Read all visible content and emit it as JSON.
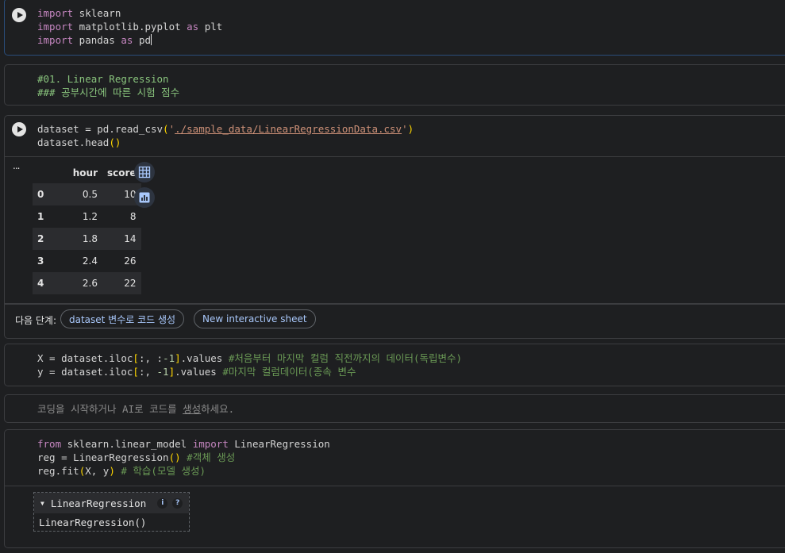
{
  "cells": {
    "import": {
      "lines": [
        {
          "kw": "import",
          "rest": " sklearn"
        },
        {
          "kw": "import",
          "rest": " matplotlib.pyplot ",
          "kw2": "as",
          "rest2": " plt"
        },
        {
          "kw": "import",
          "rest": " pandas ",
          "kw2": "as",
          "rest2": " pd"
        }
      ]
    },
    "markdown1": {
      "line1": "#01. Linear Regression",
      "line2": "### 공부시간에 따른 시험 점수"
    },
    "readcsv": {
      "l1_a": "dataset = pd.read_csv",
      "l1_paren_open": "(",
      "l1_quote_open": "'",
      "l1_path": "./sample_data/LinearRegressionData.csv",
      "l1_quote_close": "'",
      "l1_paren_close": ")",
      "l2_a": "dataset.head",
      "l2_parens": "()"
    },
    "output": {
      "ellipsis": "...",
      "table": {
        "columns": [
          "",
          "hour",
          "score"
        ],
        "rows": [
          [
            "0",
            "0.5",
            "10"
          ],
          [
            "1",
            "1.2",
            "8"
          ],
          [
            "2",
            "1.8",
            "14"
          ],
          [
            "3",
            "2.4",
            "26"
          ],
          [
            "4",
            "2.6",
            "22"
          ]
        ]
      },
      "next_steps_label": "다음 단계:",
      "chip1": "dataset 변수로 코드 생성",
      "chip2": "New interactive sheet",
      "table_icon": "table-icon",
      "chart_icon": "bar-chart-icon"
    },
    "iloc": {
      "l1_a": "X = dataset.iloc",
      "l1_b": "[",
      "l1_c": ":, :",
      "l1_d": "-1",
      "l1_e": "]",
      "l1_f": ".values ",
      "l1_cm": "#처음부터 마지막 컬럼 직전까지의 데이터(독립변수)",
      "l2_a": "y = dataset.iloc",
      "l2_b": "[",
      "l2_c": ":, ",
      "l2_d": "-1",
      "l2_e": "]",
      "l2_f": ".values ",
      "l2_cm": "#마지막 컬럼데이터(종속 변수"
    },
    "empty": {
      "placeholder_a": "코딩을 시작하거나 AI로 코드를 ",
      "placeholder_link": "생성",
      "placeholder_b": "하세요."
    },
    "fit": {
      "l1_kw1": "from",
      "l1_mod": " sklearn.linear_model ",
      "l1_kw2": "import",
      "l1_cls": " LinearRegression",
      "l2_a": "reg = LinearRegression",
      "l2_p": "()",
      "l2_cm": " #객체 생성",
      "l3_a": "reg.fit",
      "l3_po": "(",
      "l3_args": "X, y",
      "l3_pc": ")",
      "l3_cm": " # 학습(모델 생성)",
      "widget_title": "LinearRegression",
      "widget_info": "i",
      "widget_help": "?",
      "widget_body": "LinearRegression()"
    }
  },
  "colors": {
    "background": "#1e1f21",
    "accent": "#a8c7fa",
    "keyword": "#c586c0",
    "comment": "#6a9955"
  }
}
